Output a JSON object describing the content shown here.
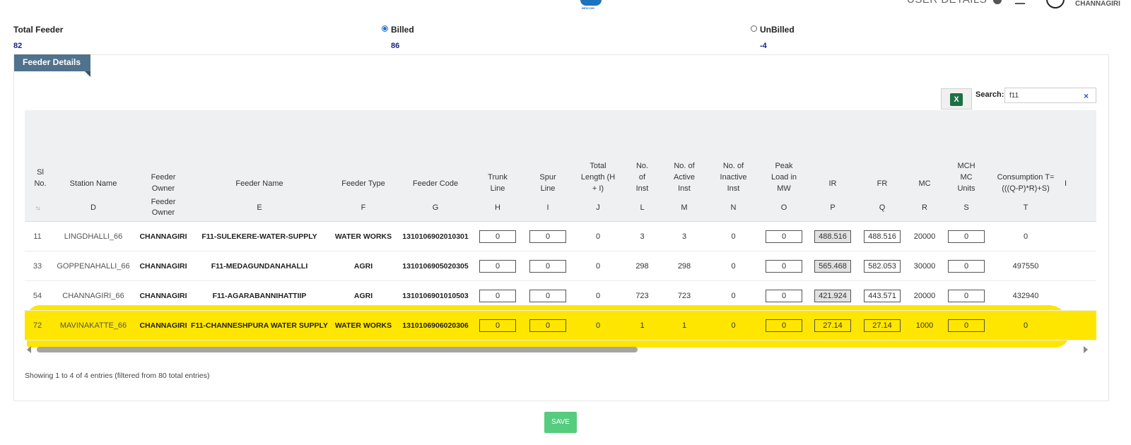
{
  "header": {
    "logo_text": "BESCOM",
    "user_details": "USER DETAILS",
    "location": "CHANNAGIRI"
  },
  "stats": {
    "total_feeder_label": "Total Feeder",
    "total_feeder_value": "82",
    "billed_label": "Billed",
    "billed_value": "86",
    "unbilled_label": "UnBilled",
    "unbilled_value": "-4",
    "selected": "Billed"
  },
  "panel": {
    "title": "Feeder Details",
    "search_label": "Search:",
    "search_value": "f11",
    "excel_icon": "excel-export-icon"
  },
  "table": {
    "headers": [
      "Sl No.",
      "Station Name",
      "Feeder Owner",
      "Feeder Name",
      "Feeder Type",
      "Feeder Code",
      "Trunk Line",
      "Spur Line",
      "Total Length (H + I)",
      "No. of Inst",
      "No. of Active Inst",
      "No. of Inactive Inst",
      "Peak Load in MW",
      "IR",
      "FR",
      "MC",
      "MCH MC Units",
      "Consumption T=(((Q-P)*R)+S)",
      "I"
    ],
    "letters": [
      "",
      "D",
      "Feeder Owner",
      "E",
      "F",
      "G",
      "H",
      "I",
      "J",
      "L",
      "M",
      "N",
      "O",
      "P",
      "Q",
      "R",
      "S",
      "T",
      ""
    ],
    "rows": [
      {
        "sl": "11",
        "station": "LINGDHALLI_66",
        "owner": "CHANNAGIRI",
        "feeder_name": "F11-SULEKERE-WATER-SUPPLY",
        "type": "WATER WORKS",
        "code": "1310106902010301",
        "trunk": "0",
        "spur": "0",
        "total_length": "0",
        "inst": "3",
        "active": "3",
        "inactive": "0",
        "peak": "0",
        "ir": "488.516",
        "fr": "488.516",
        "mc": "20000",
        "mch": "0",
        "consumption": "0"
      },
      {
        "sl": "33",
        "station": "GOPPENAHALLI_66",
        "owner": "CHANNAGIRI",
        "feeder_name": "F11-MEDAGUNDANAHALLI",
        "type": "AGRI",
        "code": "1310106905020305",
        "trunk": "0",
        "spur": "0",
        "total_length": "0",
        "inst": "298",
        "active": "298",
        "inactive": "0",
        "peak": "0",
        "ir": "565.468",
        "fr": "582.053",
        "mc": "30000",
        "mch": "0",
        "consumption": "497550"
      },
      {
        "sl": "54",
        "station": "CHANNAGIRI_66",
        "owner": "CHANNAGIRI",
        "feeder_name": "F11-AGARABANNIHATTIIP",
        "type": "AGRI",
        "code": "1310106901010503",
        "trunk": "0",
        "spur": "0",
        "total_length": "0",
        "inst": "723",
        "active": "723",
        "inactive": "0",
        "peak": "0",
        "ir": "421.924",
        "fr": "443.571",
        "mc": "20000",
        "mch": "0",
        "consumption": "432940"
      },
      {
        "sl": "72",
        "station": "MAVINAKATTE_66",
        "owner": "CHANNAGIRI",
        "feeder_name": "F11-CHANNESHPURA WATER SUPPLY",
        "type": "WATER WORKS",
        "code": "1310106906020306",
        "trunk": "0",
        "spur": "0",
        "total_length": "0",
        "inst": "1",
        "active": "1",
        "inactive": "0",
        "peak": "0",
        "ir": "27.14",
        "fr": "27.14",
        "mc": "1000",
        "mch": "0",
        "consumption": "0"
      }
    ],
    "highlight_color": "#ffe600"
  },
  "footer": {
    "entries_text": "Showing 1 to 4 of 4 entries (filtered from 80 total entries)",
    "save_label": "SAVE"
  }
}
